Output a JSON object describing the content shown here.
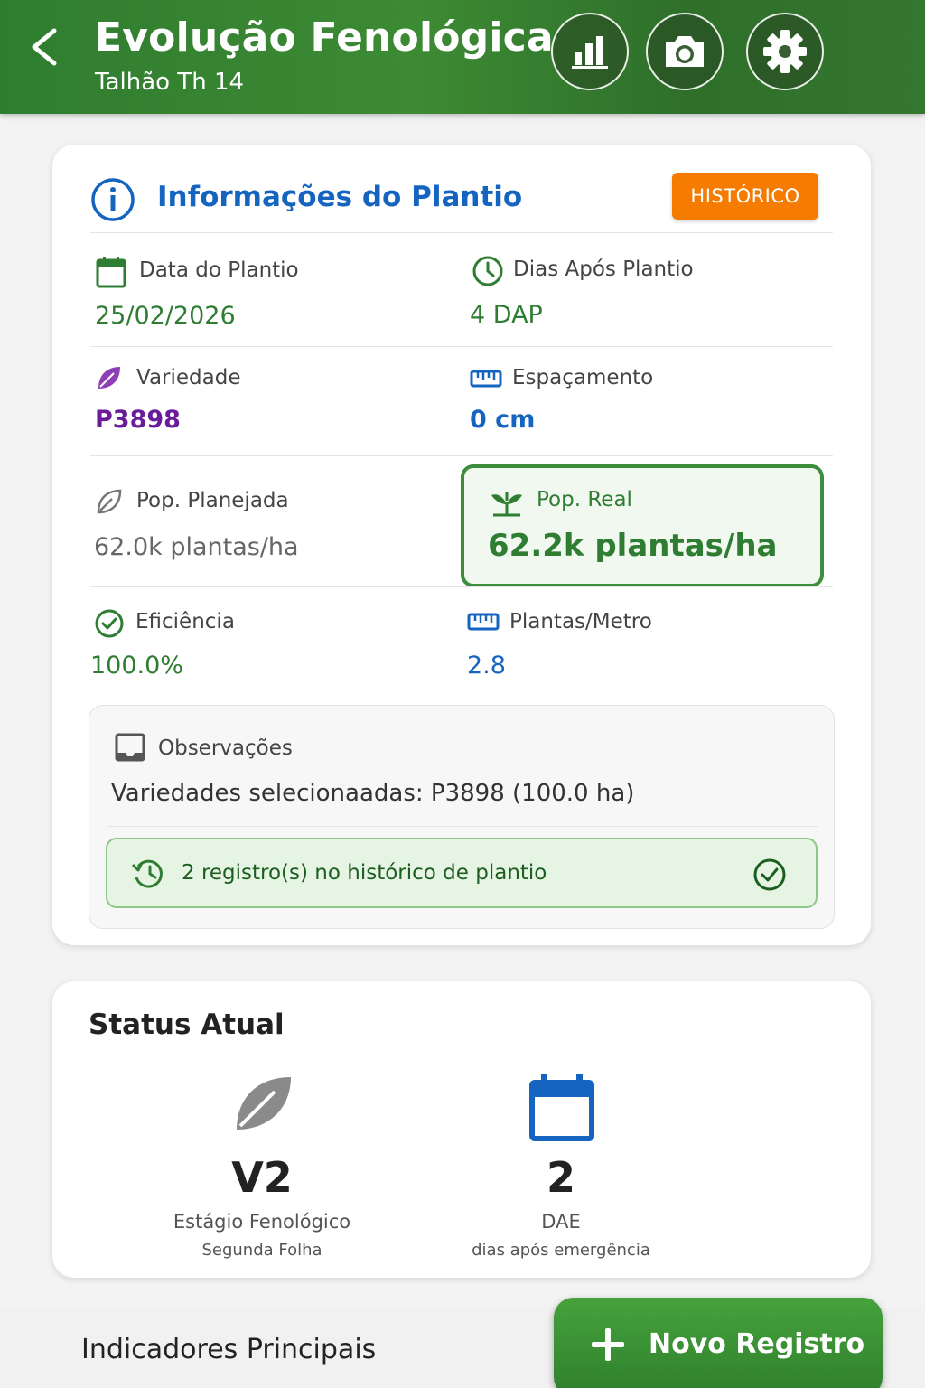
{
  "header": {
    "title": "Evolução Fenológica",
    "subtitle": "Talhão Th 14",
    "actions": [
      "chart-icon",
      "camera-icon",
      "gear-icon"
    ]
  },
  "plantio": {
    "title": "Informações do Plantio",
    "historico_label": "HISTÓRICO",
    "data_plantio": {
      "label": "Data do Plantio",
      "value": "25/02/2026"
    },
    "dias_apos": {
      "label": "Dias Após Plantio",
      "value": "4 DAP"
    },
    "variedade": {
      "label": "Variedade",
      "value": "P3898"
    },
    "espacamento": {
      "label": "Espaçamento",
      "value": "0 cm"
    },
    "pop_planejada": {
      "label": "Pop. Planejada",
      "value": "62.0k plantas/ha"
    },
    "pop_real": {
      "label": "Pop. Real",
      "value": "62.2k plantas/ha"
    },
    "eficiencia": {
      "label": "Eficiência",
      "value": "100.0%"
    },
    "plantas_metro": {
      "label": "Plantas/Metro",
      "value": "2.8"
    },
    "observacoes": {
      "label": "Observações",
      "text": "Variedades selecionaadas: P3898 (100.0 ha)",
      "banner": "2 registro(s) no histórico de plantio"
    }
  },
  "status": {
    "title": "Status Atual",
    "estagio": {
      "value": "V2",
      "label": "Estágio Fenológico",
      "sub": "Segunda Folha"
    },
    "dae": {
      "value": "2",
      "label": "DAE",
      "sub": "dias após emergência"
    }
  },
  "indicadores_title": "Indicadores Principais",
  "fab_label": "Novo Registro",
  "colors": {
    "header_green": "#2f7d2f",
    "accent_blue": "#1565c0",
    "value_green": "#2e7d32",
    "variety_purple": "#6a1b9a",
    "history_orange": "#f57c00"
  }
}
